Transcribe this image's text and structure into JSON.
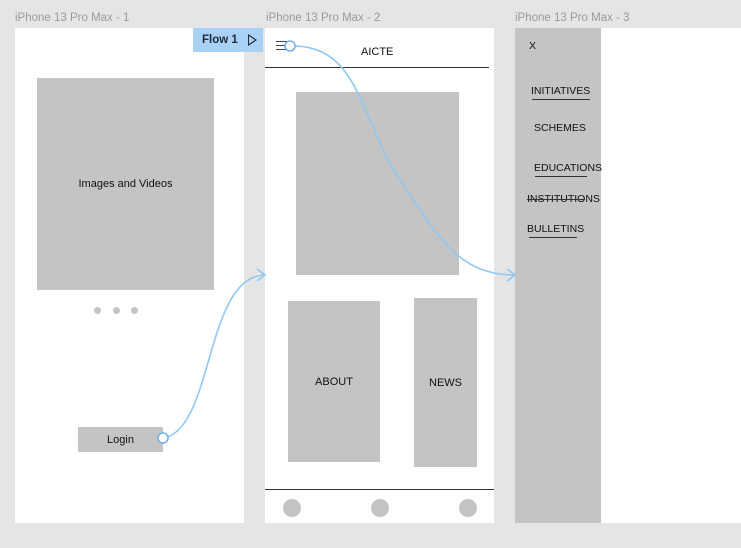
{
  "frames": [
    {
      "label": "iPhone 13 Pro Max - 1"
    },
    {
      "label": "iPhone 13 Pro Max - 2"
    },
    {
      "label": "iPhone 13 Pro Max - 3"
    }
  ],
  "flow": {
    "label": "Flow 1"
  },
  "screen1": {
    "media_label": "Images and Videos",
    "login_label": "Login"
  },
  "screen2": {
    "header_title": "AICTE",
    "about_label": "ABOUT",
    "news_label": "NEWS"
  },
  "screen3": {
    "close_label": "X",
    "menu": [
      "INITIATIVES",
      "SCHEMES",
      "EDUCATIONS",
      "INSTITUTIONS",
      "BULLETINS"
    ]
  },
  "colors": {
    "canvas": "#e5e5e5",
    "frame": "#ffffff",
    "placeholder": "#c4c4c4",
    "flow_accent": "#a9d1f5",
    "prototype_line": "#90c8f3"
  },
  "icons": [
    "hamburger-icon",
    "play-icon",
    "carousel-dots"
  ]
}
